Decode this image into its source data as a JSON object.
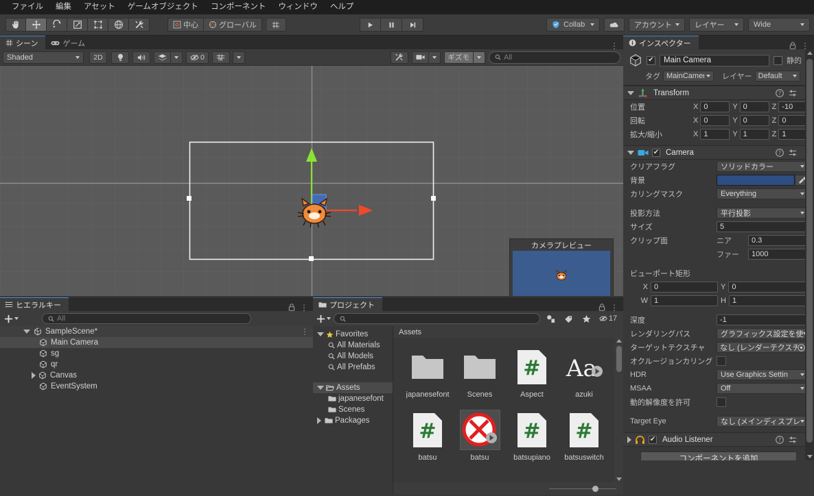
{
  "menu": {
    "items": [
      "ファイル",
      "編集",
      "アセット",
      "ゲームオブジェクト",
      "コンポーネント",
      "ウィンドウ",
      "ヘルプ"
    ]
  },
  "toolbar": {
    "tools": [
      {
        "name": "hand-tool",
        "icon": "hand"
      },
      {
        "name": "move-tool",
        "icon": "move"
      },
      {
        "name": "rotate-tool",
        "icon": "rotate"
      },
      {
        "name": "scale-tool",
        "icon": "scale"
      },
      {
        "name": "rect-tool",
        "icon": "rect"
      },
      {
        "name": "transform-tool",
        "icon": "transform"
      },
      {
        "name": "custom-tool",
        "icon": "wrench"
      }
    ],
    "pivot_label": "中心",
    "handle_label": "グローバル",
    "grid_label": "",
    "play_label": "▶",
    "pause_label": "❚❚",
    "step_label": "▶❚",
    "collab_label": "Collab",
    "cloud_label": "",
    "account_label": "アカウント",
    "layers_label": "レイヤー",
    "layout_label": "Wide"
  },
  "scene": {
    "tabs": [
      {
        "label": "シーン",
        "icon": "grid-icon",
        "active": true
      },
      {
        "label": "ゲーム",
        "icon": "gamepad-icon",
        "active": false
      }
    ],
    "draw_mode": "Shaded",
    "btn_2d": "2D",
    "gizmos_label": "ギズモ",
    "audio_count": "0",
    "search_placeholder": "All",
    "camera_preview_title": "カメラプレビュー",
    "camera_preview_bg": "#3b5c8f",
    "grid_bg": "#5a5a5a",
    "gizmo_x_color": "#f04a2a",
    "gizmo_y_color": "#8ae234"
  },
  "hierarchy": {
    "tab_label": "ヒエラルキー",
    "search_placeholder": "All",
    "rows": [
      {
        "label": "SampleScene*",
        "depth": 0,
        "icon": "scene-icon",
        "expanded": true,
        "selected": false
      },
      {
        "label": "Main Camera",
        "depth": 1,
        "icon": "gameobject-icon",
        "expanded": null,
        "selected": true
      },
      {
        "label": "sg",
        "depth": 1,
        "icon": "gameobject-icon",
        "expanded": null,
        "selected": false
      },
      {
        "label": "qr",
        "depth": 1,
        "icon": "gameobject-icon",
        "expanded": null,
        "selected": false
      },
      {
        "label": "Canvas",
        "depth": 1,
        "icon": "gameobject-icon",
        "expanded": false,
        "selected": false
      },
      {
        "label": "EventSystem",
        "depth": 1,
        "icon": "gameobject-icon",
        "expanded": null,
        "selected": false
      }
    ]
  },
  "project": {
    "tab_label": "プロジェクト",
    "search_placeholder": "",
    "hidden_count": "17",
    "breadcrumb": "Assets",
    "tree": [
      {
        "label": "Favorites",
        "depth": 0,
        "icon": "star-icon",
        "expanded": true,
        "selected": false
      },
      {
        "label": "All Materials",
        "depth": 1,
        "icon": "search-icon",
        "expanded": null,
        "selected": false
      },
      {
        "label": "All Models",
        "depth": 1,
        "icon": "search-icon",
        "expanded": null,
        "selected": false
      },
      {
        "label": "All Prefabs",
        "depth": 1,
        "icon": "search-icon",
        "expanded": null,
        "selected": false
      },
      {
        "label": "",
        "depth": 0,
        "icon": "spacer",
        "expanded": null,
        "selected": false
      },
      {
        "label": "Assets",
        "depth": 0,
        "icon": "folder-open-icon",
        "expanded": true,
        "selected": true
      },
      {
        "label": "japanesefont",
        "depth": 1,
        "icon": "folder-icon",
        "expanded": null,
        "selected": false
      },
      {
        "label": "Scenes",
        "depth": 1,
        "icon": "folder-icon",
        "expanded": null,
        "selected": false
      },
      {
        "label": "Packages",
        "depth": 0,
        "icon": "folder-icon",
        "expanded": false,
        "selected": false
      }
    ],
    "assets": [
      {
        "label": "japanesefont",
        "type": "folder",
        "selected": false
      },
      {
        "label": "Scenes",
        "type": "folder",
        "selected": false
      },
      {
        "label": "Aspect",
        "type": "script",
        "selected": false
      },
      {
        "label": "azuki",
        "type": "font",
        "selected": false
      },
      {
        "label": "batsu",
        "type": "script",
        "selected": false
      },
      {
        "label": "batsu",
        "type": "image-batsu",
        "selected": true
      },
      {
        "label": "batsupiano",
        "type": "script",
        "selected": false
      },
      {
        "label": "batsuswitch",
        "type": "script",
        "selected": false
      }
    ]
  },
  "inspector": {
    "tab_label": "インスペクター",
    "object_name": "Main Camera",
    "object_enabled": true,
    "static_label": "静的",
    "tag_label": "タグ",
    "tag_value": "MainCamer",
    "layer_label": "レイヤー",
    "layer_value": "Default",
    "components": [
      {
        "name": "Transform",
        "icon": "transform-icon",
        "has_checkbox": false,
        "rows": [
          {
            "label": "位置",
            "type": "vec3",
            "x": "0",
            "y": "0",
            "z": "-10"
          },
          {
            "label": "回転",
            "type": "vec3",
            "x": "0",
            "y": "0",
            "z": "0"
          },
          {
            "label": "拡大/縮小",
            "type": "vec3",
            "x": "1",
            "y": "1",
            "z": "1"
          }
        ]
      },
      {
        "name": "Camera",
        "icon": "camera-icon",
        "has_checkbox": true,
        "checked": true,
        "rows": [
          {
            "label": "クリアフラグ",
            "type": "dropdown",
            "value": "ソリッドカラー"
          },
          {
            "label": "背景",
            "type": "color",
            "value": "#2e4d82"
          },
          {
            "label": "カリングマスク",
            "type": "dropdown",
            "value": "Everything"
          },
          {
            "label": "",
            "type": "spacer"
          },
          {
            "label": "投影方法",
            "type": "dropdown",
            "value": "平行投影"
          },
          {
            "label": "サイズ",
            "type": "field",
            "value": "5"
          },
          {
            "label": "クリップ面",
            "type": "clip",
            "near_label": "ニア",
            "near": "0.3",
            "far_label": "ファー",
            "far": "1000"
          },
          {
            "label": "",
            "type": "spacer"
          },
          {
            "label": "ビューポート矩形",
            "type": "section"
          },
          {
            "label": "",
            "type": "xy",
            "x_label": "X",
            "x": "0",
            "y_label": "Y",
            "y": "0"
          },
          {
            "label": "",
            "type": "xy",
            "x_label": "W",
            "x": "1",
            "y_label": "H",
            "y": "1"
          },
          {
            "label": "",
            "type": "spacer"
          },
          {
            "label": "深度",
            "type": "field",
            "value": "-1"
          },
          {
            "label": "レンダリングパス",
            "type": "dropdown",
            "value": "グラフィックス設定を使"
          },
          {
            "label": "ターゲットテクスチャ",
            "type": "objectfield",
            "value": "なし (レンダーテクスチ"
          },
          {
            "label": "オクルージョンカリング",
            "type": "checkbox",
            "checked": false
          },
          {
            "label": "HDR",
            "type": "dropdown",
            "value": "Use Graphics Settin"
          },
          {
            "label": "MSAA",
            "type": "dropdown",
            "value": "Off"
          },
          {
            "label": "動的解像度を許可",
            "type": "checkbox",
            "checked": false
          },
          {
            "label": "",
            "type": "spacer"
          },
          {
            "label": "Target Eye",
            "type": "dropdown",
            "value": "なし (メインディスプレ"
          }
        ]
      },
      {
        "name": "Audio Listener",
        "icon": "headphones-icon",
        "has_checkbox": true,
        "checked": true,
        "rows": []
      }
    ],
    "add_component_label": "コンポーネントを追加"
  }
}
